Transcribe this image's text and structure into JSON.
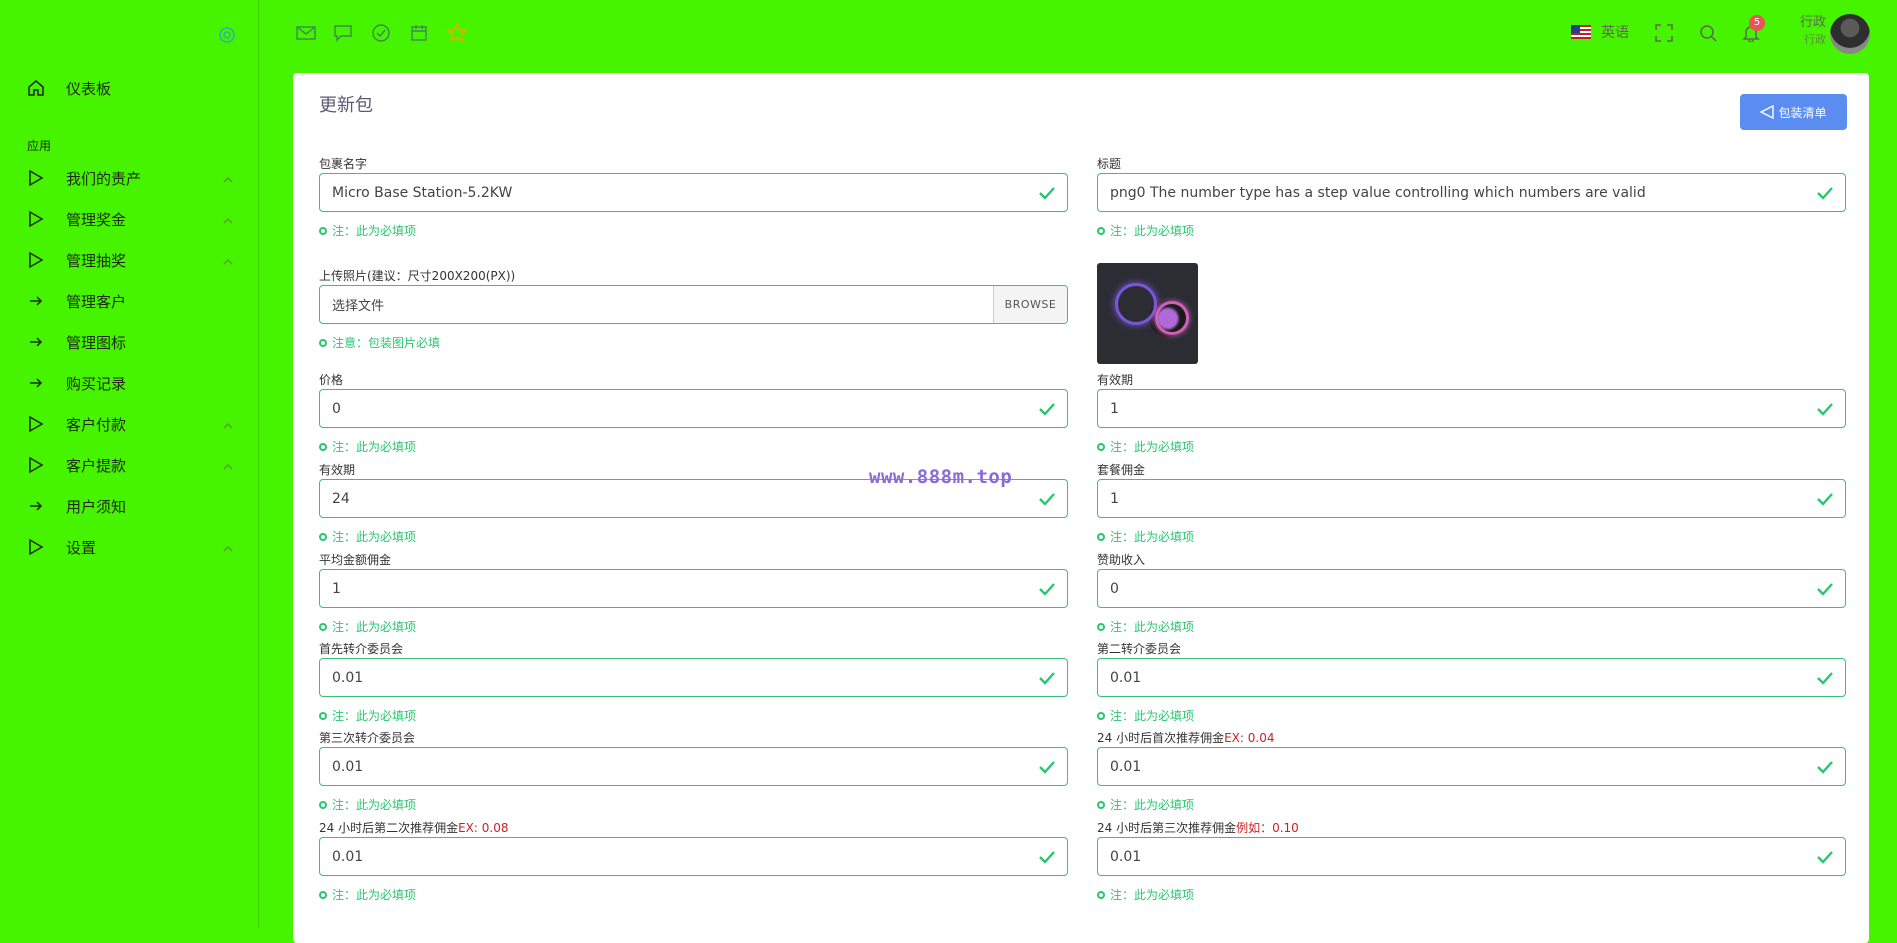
{
  "sidebar": {
    "items": [
      {
        "label": "仪表板",
        "icon": "home-icon"
      },
      {
        "label": "我们的责产",
        "icon": "play-icon"
      },
      {
        "label": "管理奖金",
        "icon": "play-icon"
      },
      {
        "label": "管理抽奖",
        "icon": "play-icon"
      },
      {
        "label": "管理客户",
        "icon": "arrow-right-icon"
      },
      {
        "label": "管理图标",
        "icon": "arrow-right-icon"
      },
      {
        "label": "购买记录",
        "icon": "arrow-right-icon"
      },
      {
        "label": "客户付款",
        "icon": "play-icon"
      },
      {
        "label": "客户提款",
        "icon": "play-icon"
      },
      {
        "label": "用户须知",
        "icon": "arrow-right-icon"
      },
      {
        "label": "设置",
        "icon": "play-icon"
      }
    ],
    "section_heading": "应用"
  },
  "topbar": {
    "language": "英语",
    "notification_count": "5",
    "user_name": "行政",
    "user_role": "行政"
  },
  "page": {
    "title": "更新包",
    "list_button": "包装清单",
    "watermark": "www.888m.top"
  },
  "form": {
    "required_note": "注：此为必填项",
    "photo_note": "注意：包装图片必填",
    "package_name": {
      "label": "包裹名字",
      "value": "Micro Base Station-5.2KW"
    },
    "title": {
      "label": "标题",
      "value": "png0 The number type has a step value controlling which numbers are valid"
    },
    "photo": {
      "label": "上传照片(建议：尺寸200X200(PX))",
      "file_text": "选择文件",
      "browse": "BROWSE"
    },
    "price": {
      "label": "价格",
      "value": "0"
    },
    "validity_right": {
      "label": "有效期",
      "value": "1"
    },
    "validity_left": {
      "label": "有效期",
      "value": "24"
    },
    "package_commission": {
      "label": "套餐佣金",
      "value": "1"
    },
    "avg_commission": {
      "label": "平均金额佣金",
      "value": "1"
    },
    "sponsor_income": {
      "label": "赞助收入",
      "value": "0"
    },
    "first_referral": {
      "label": "首先转介委员会",
      "value": "0.01"
    },
    "second_referral": {
      "label": "第二转介委员会",
      "value": "0.01"
    },
    "third_referral": {
      "label": "第三次转介委员会",
      "value": "0.01"
    },
    "first_24h": {
      "label": "24 小时后首次推荐佣金",
      "ex": "EX: 0.04",
      "value": "0.01"
    },
    "second_24h": {
      "label": "24 小时后第二次推荐佣金",
      "ex": "EX: 0.08",
      "value": "0.01"
    },
    "third_24h": {
      "label": "24 小时后第三次推荐佣金",
      "ex": "例如：0.10",
      "value": "0.01"
    }
  }
}
